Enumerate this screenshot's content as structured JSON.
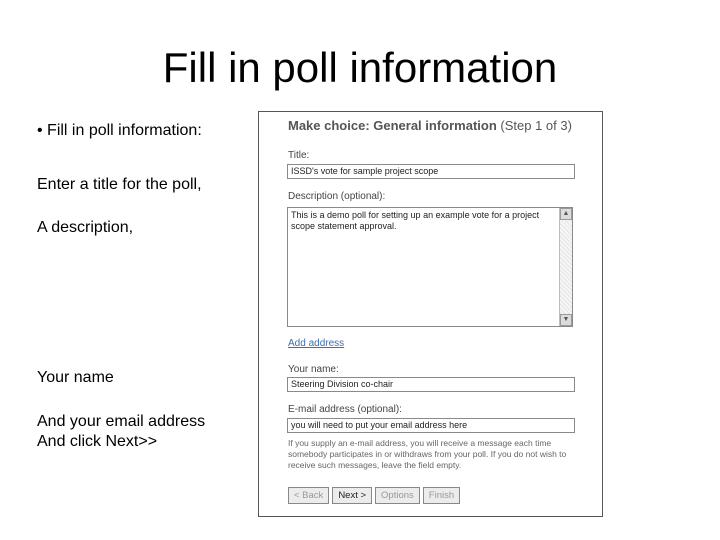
{
  "slide": {
    "title": "Fill in poll information",
    "bullets": [
      "• Fill in poll information:",
      "Enter a title for the poll,",
      "A description,",
      "Your name",
      "And your email address",
      "And click Next>>"
    ]
  },
  "form": {
    "heading": "Make choice: General information",
    "step": "(Step 1 of 3)",
    "title_label": "Title:",
    "title_value": "ISSD's vote for sample project scope",
    "description_label": "Description (optional):",
    "description_value": "This is a demo poll for setting up an example vote for a project scope statement approval.",
    "add_address_link": "Add address",
    "name_label": "Your name:",
    "name_value": "Steering Division co-chair",
    "email_label": "E-mail address (optional):",
    "email_value": "you will need to put your email address here",
    "help_text": "If you supply an e-mail address, you will receive a message each time somebody participates in or withdraws from your poll. If you do not wish to receive such messages, leave the field empty.",
    "buttons": {
      "back": "< Back",
      "next": "Next >",
      "options": "Options",
      "finish": "Finish"
    }
  }
}
